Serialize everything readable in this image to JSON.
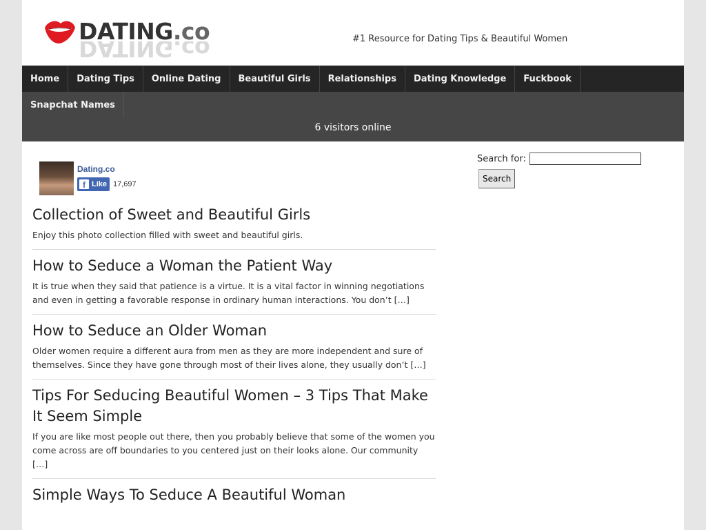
{
  "header": {
    "logo_text": "DATING",
    "logo_suffix": ".co",
    "logo_reflection": "DATING.co",
    "tagline": "#1 Resource for Dating Tips & Beautiful Women"
  },
  "nav": {
    "row1": [
      "Home",
      "Dating Tips",
      "Online Dating",
      "Beautiful Girls",
      "Relationships",
      "Dating Knowledge",
      "Fuckbook"
    ],
    "row2": [
      "Snapchat Names"
    ]
  },
  "visitors_text": "6 visitors online",
  "fb": {
    "page_name": "Dating.co",
    "like_label": "Like",
    "like_count": "17,697"
  },
  "posts": [
    {
      "title": "Collection of Sweet and Beautiful Girls",
      "excerpt": "Enjoy this photo collection filled with sweet and beautiful girls."
    },
    {
      "title": "How to Seduce a Woman the Patient Way",
      "excerpt": "It is true when they said that patience is a virtue. It is a vital factor in winning negotiations and even in getting a favorable response in ordinary human interactions. You don’t […]"
    },
    {
      "title": "How to Seduce an Older Woman",
      "excerpt": "Older women require a different aura from men as they are more independent and sure of themselves. Since they have gone through most of their lives alone, they usually don’t […]"
    },
    {
      "title": "Tips For Seducing Beautiful Women – 3 Tips That Make It Seem Simple",
      "excerpt": "If you are like most people out there, then you probably believe that some of the women you come across are off boundaries to you centered just on their looks alone. Our community […]"
    },
    {
      "title": "Simple Ways To Seduce A Beautiful Woman",
      "excerpt": ""
    }
  ],
  "sidebar": {
    "search_label": "Search for:",
    "search_value": "",
    "search_button": "Search"
  },
  "colors": {
    "nav_dark": "#252525",
    "nav_mid": "#464646",
    "lips_red": "#e01a22",
    "fb_blue": "#4267b2"
  }
}
